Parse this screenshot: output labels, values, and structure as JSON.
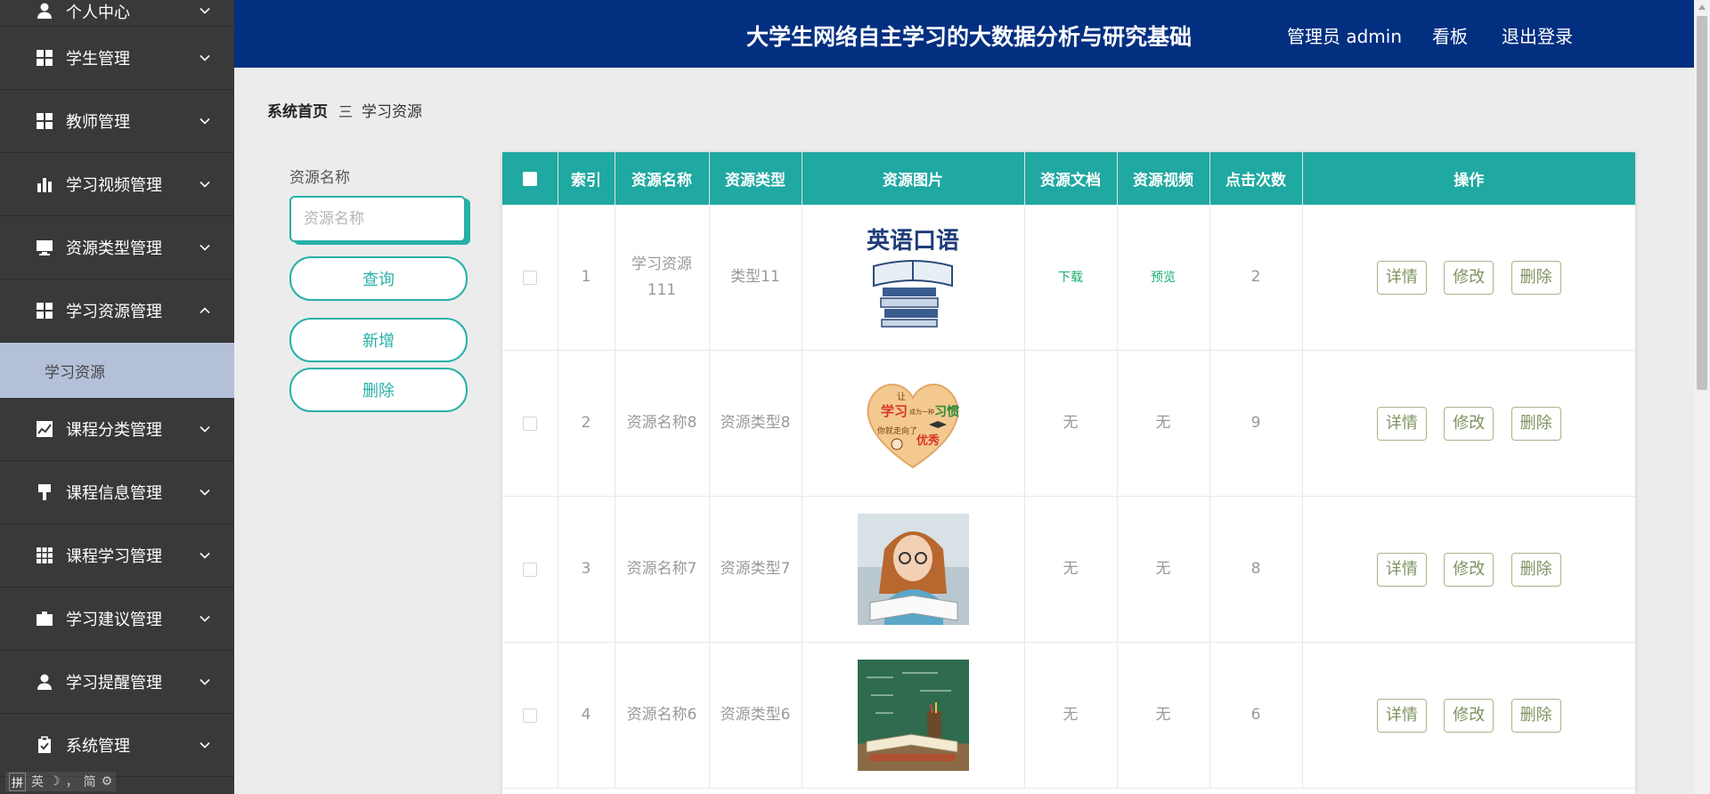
{
  "header": {
    "title": "大学生网络自主学习的大数据分析与研究基础",
    "user_label": "管理员 admin",
    "dashboard_label": "看板",
    "logout_label": "退出登录"
  },
  "sidebar": {
    "items": [
      {
        "label": "个人中心",
        "icon": "user-icon"
      },
      {
        "label": "学生管理",
        "icon": "grid-icon"
      },
      {
        "label": "教师管理",
        "icon": "grid-icon"
      },
      {
        "label": "学习视频管理",
        "icon": "bar-chart-icon"
      },
      {
        "label": "资源类型管理",
        "icon": "monitor-icon"
      },
      {
        "label": "学习资源管理",
        "icon": "grid-icon",
        "expanded": true
      },
      {
        "label": "课程分类管理",
        "icon": "line-chart-icon"
      },
      {
        "label": "课程信息管理",
        "icon": "brush-icon"
      },
      {
        "label": "课程学习管理",
        "icon": "grid-nine-icon"
      },
      {
        "label": "学习建议管理",
        "icon": "briefcase-icon"
      },
      {
        "label": "学习提醒管理",
        "icon": "user-alt-icon"
      },
      {
        "label": "系统管理",
        "icon": "clipboard-icon"
      }
    ],
    "submenu_label": "学习资源"
  },
  "breadcrumb": {
    "home": "系统首页",
    "separator": "三",
    "current": "学习资源"
  },
  "search": {
    "label": "资源名称",
    "placeholder": "资源名称",
    "query_button": "查询",
    "add_button": "新增",
    "delete_button": "删除"
  },
  "table": {
    "headers": [
      "索引",
      "资源名称",
      "资源类型",
      "资源图片",
      "资源文档",
      "资源视频",
      "点击次数",
      "操作"
    ],
    "rows": [
      {
        "index": "1",
        "name": "学习资源111",
        "type": "类型11",
        "image": "english-books",
        "doc": "下载",
        "video": "预览",
        "clicks": "2"
      },
      {
        "index": "2",
        "name": "资源名称8",
        "type": "资源类型8",
        "image": "heart-study",
        "doc": "无",
        "video": "无",
        "clicks": "9"
      },
      {
        "index": "3",
        "name": "资源名称7",
        "type": "资源类型7",
        "image": "girl-reading",
        "doc": "无",
        "video": "无",
        "clicks": "8"
      },
      {
        "index": "4",
        "name": "资源名称6",
        "type": "资源类型6",
        "image": "books-chalkboard",
        "doc": "无",
        "video": "无",
        "clicks": "6"
      }
    ],
    "actions": {
      "detail": "详情",
      "edit": "修改",
      "delete": "删除"
    }
  },
  "image_text": {
    "english_banner": "英语口语",
    "heart_top": "让",
    "heart_main1": "学习",
    "heart_small": "成为一种",
    "heart_main2": "习惯",
    "heart_line2": "你就走向了",
    "heart_line3": "优秀"
  },
  "ime": {
    "items": [
      "拼",
      "英",
      "☽",
      "，",
      "简",
      "⚙"
    ]
  },
  "colors": {
    "header_bg": "#022f80",
    "sidebar_bg": "#393939",
    "accent": "#20a8a2",
    "submenu_bg": "#b4c0d8"
  }
}
